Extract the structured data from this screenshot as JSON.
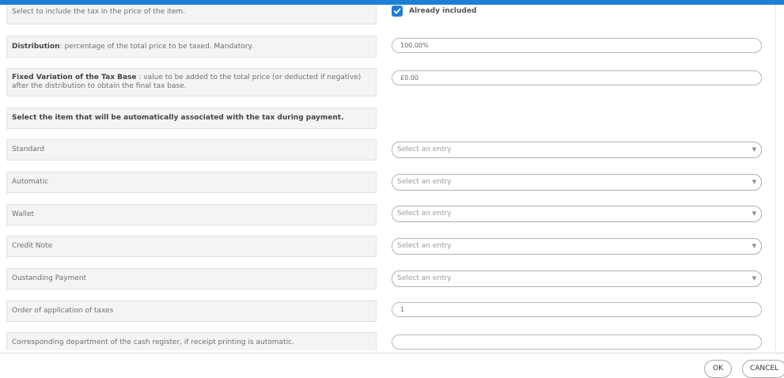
{
  "tax_form": {
    "included": {
      "label": "Select to include the tax in the price of the item.",
      "checkbox_label": "Already included",
      "checked": true
    },
    "distribution": {
      "label_bold": "Distribution",
      "label_rest": ": percentage of the total price to be taxed. Mandatory.",
      "value": "100.00%"
    },
    "fixed_variation": {
      "label_bold": "Fixed Variation of the Tax Base",
      "label_rest": " : value to be added to the total price (or deducted if negative) after the distribution to obtain the final tax base.",
      "value": "£0.00"
    },
    "section_heading": "Select the item that will be automatically associated with the tax during payment.",
    "items": [
      {
        "label": "Standard",
        "placeholder": "Select an entry"
      },
      {
        "label": "Automatic",
        "placeholder": "Select an entry"
      },
      {
        "label": "Wallet",
        "placeholder": "Select an entry"
      },
      {
        "label": "Credit Note",
        "placeholder": "Select an entry"
      },
      {
        "label": "Oustanding Payment",
        "placeholder": "Select an entry"
      }
    ],
    "order": {
      "label": "Order of application of taxes",
      "value": "1"
    },
    "department": {
      "label": "Corresponding department of the cash register, if receipt printing is automatic.",
      "value": ""
    }
  },
  "footer": {
    "ok_label": "OK",
    "cancel_label": "CANCEL"
  },
  "colors": {
    "accent": "#1b7fd6"
  },
  "icons": {
    "select_arrow": "chevron-down-icon",
    "check": "checkmark-icon"
  }
}
